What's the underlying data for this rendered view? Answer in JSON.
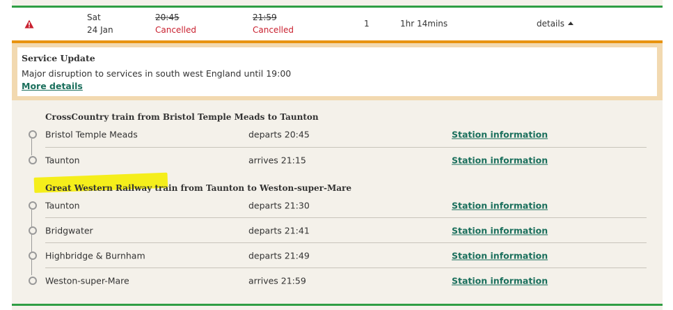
{
  "summary": {
    "day": "Sat",
    "date": "24 Jan",
    "depart_time": "20:45",
    "depart_status": "Cancelled",
    "arrive_time": "21:59",
    "arrive_status": "Cancelled",
    "changes": "1",
    "duration": "1hr 14mins",
    "details_label": "details"
  },
  "alert": {
    "title": "Service Update",
    "message": "Major disruption to services in south west England until 19:00",
    "link": "More details"
  },
  "legs": [
    {
      "title": "CrossCountry train from Bristol Temple Meads to Taunton",
      "stops": [
        {
          "name": "Bristol Temple Meads",
          "time": "departs 20:45",
          "link": "Station information"
        },
        {
          "name": "Taunton",
          "time": "arrives 21:15",
          "link": "Station information"
        }
      ]
    },
    {
      "title": "Great Western Railway train from Taunton to Weston-super-Mare",
      "stops": [
        {
          "name": "Taunton",
          "time": "departs 21:30",
          "link": "Station information"
        },
        {
          "name": "Bridgwater",
          "time": "departs 21:41",
          "link": "Station information"
        },
        {
          "name": "Highbridge & Burnham",
          "time": "departs 21:49",
          "link": "Station information"
        },
        {
          "name": "Weston-super-Mare",
          "time": "arrives 21:59",
          "link": "Station information"
        }
      ]
    }
  ],
  "colors": {
    "accent_green": "#2f9e44",
    "alert_orange": "#e8930f",
    "cancel_red": "#c9202f",
    "link_teal": "#1a6f5c",
    "highlight_yellow": "#f5ee1b"
  },
  "icons": {
    "warning": "warning-triangle-icon",
    "caret": "caret-up-icon",
    "stop": "stop-circle-icon"
  }
}
